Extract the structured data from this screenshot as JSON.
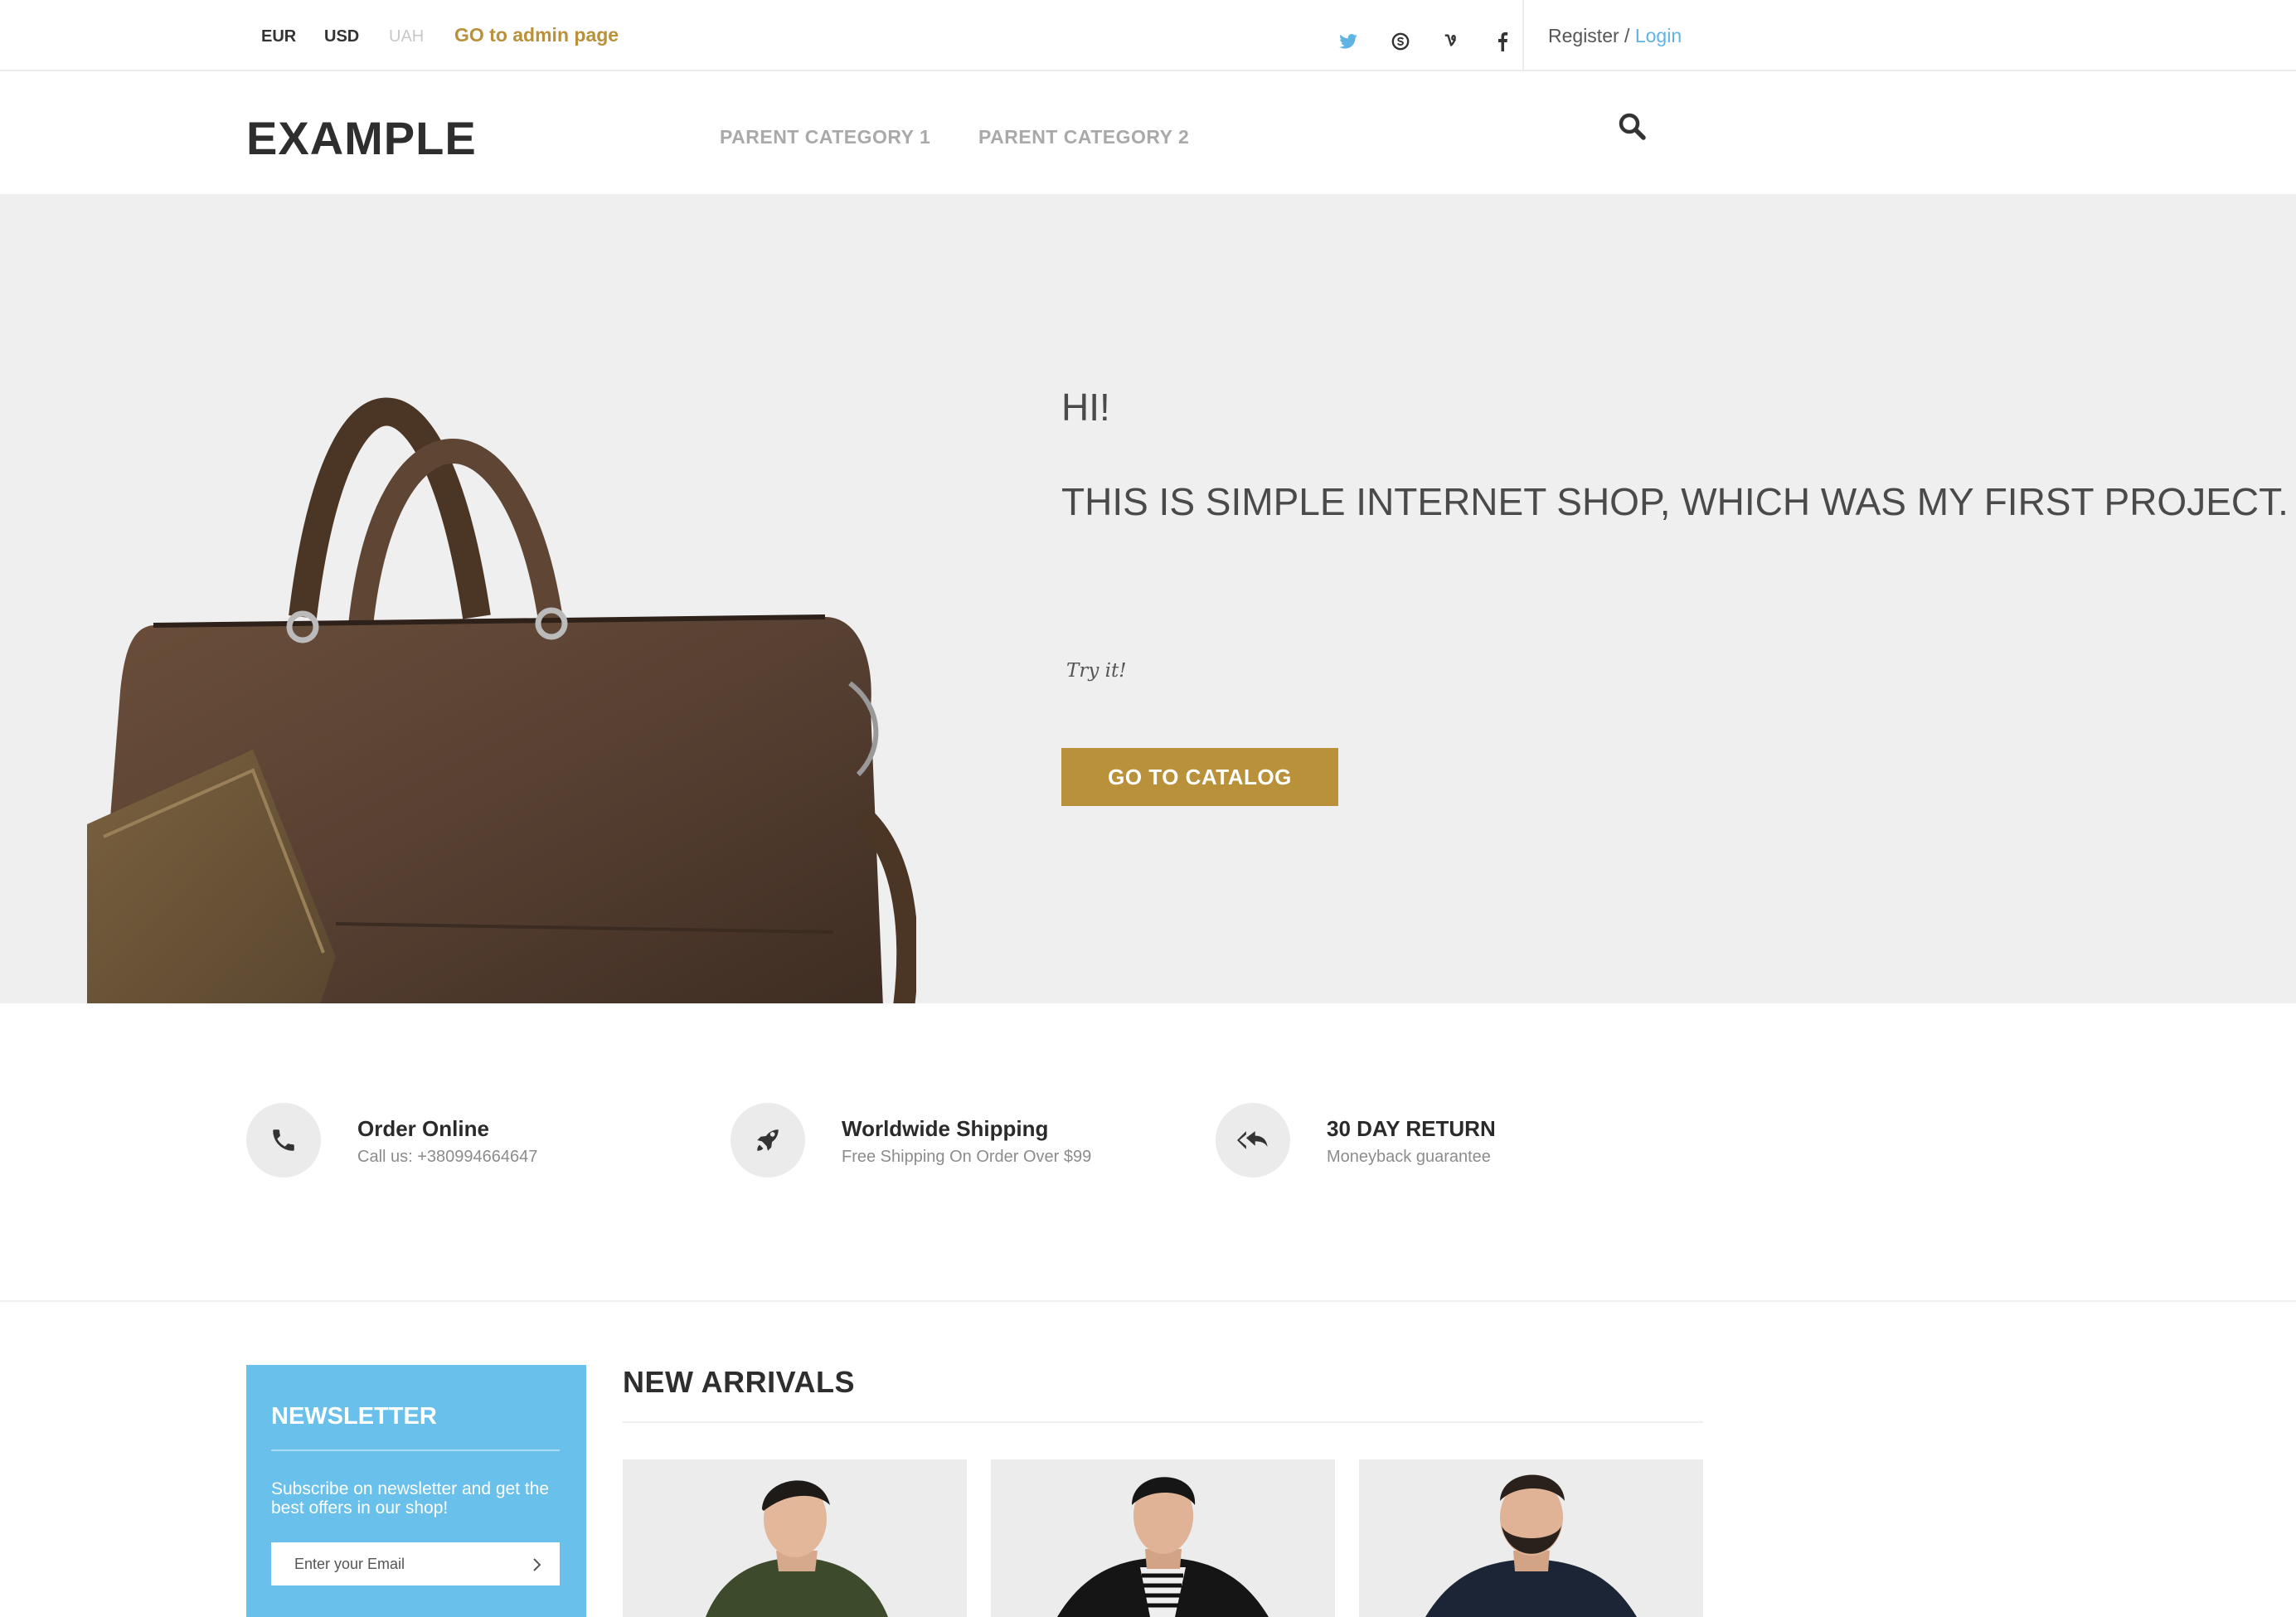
{
  "topbar": {
    "currencies": [
      {
        "code": "EUR",
        "active": true
      },
      {
        "code": "USD",
        "active": true
      },
      {
        "code": "UAH",
        "active": false
      }
    ],
    "admin_link": "GO to admin page",
    "social": [
      "twitter-icon",
      "skype-icon",
      "vine-icon",
      "facebook-icon"
    ],
    "register": "Register",
    "separator": " / ",
    "login": "Login"
  },
  "header": {
    "logo": "EXAMPLE",
    "nav": [
      "PARENT CATEGORY 1",
      "PARENT CATEGORY 2"
    ],
    "search_icon": "search-icon"
  },
  "hero": {
    "greeting": "HI!",
    "subtitle": "THIS IS SIMPLE INTERNET SHOP, WHICH WAS MY FIRST PROJECT.",
    "tagline": "Try it!",
    "button": "GO TO CATALOG",
    "image": "leather-bag"
  },
  "features": [
    {
      "icon": "phone-icon",
      "title": "Order Online",
      "desc": "Call us: +380994664647"
    },
    {
      "icon": "rocket-icon",
      "title": "Worldwide Shipping",
      "desc": "Free Shipping On Order Over $99"
    },
    {
      "icon": "reply-all-icon",
      "title": "30 DAY RETURN",
      "desc": "Moneyback guarantee"
    }
  ],
  "newsletter": {
    "title": "NEWSLETTER",
    "text": "Subscribe on newsletter and get the best offers in our shop!",
    "placeholder": "Enter your Email"
  },
  "arrivals": {
    "title": "NEW ARRIVALS"
  },
  "colors": {
    "accent_gold": "#b8913a",
    "link_blue": "#5fb3e3",
    "newsletter_blue": "#68c0eb",
    "hero_bg": "#f0eff0"
  }
}
